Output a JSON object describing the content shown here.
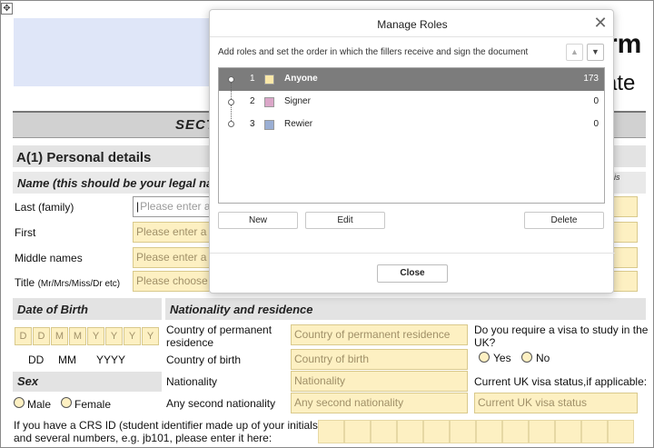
{
  "form": {
    "title_right_1": "rm",
    "title_right_2": "ate",
    "section_title": "SECT",
    "section_a1": "A(1) Personal details",
    "name_subhead": "Name (this should be your legal na",
    "name_subhead_right": "is",
    "rows": [
      {
        "label": "Last (family)",
        "placeholder": "Please enter a l"
      },
      {
        "label": "First",
        "placeholder": "Please enter a f"
      },
      {
        "label": "Middle names",
        "placeholder": "Please enter a n"
      },
      {
        "label": "Title",
        "label_small": "(Mr/Mrs/Miss/Dr etc)",
        "placeholder": "Please choose a"
      }
    ],
    "dob": {
      "heading": "Date of Birth",
      "boxes": [
        "D",
        "D",
        "M",
        "M",
        "Y",
        "Y",
        "Y",
        "Y"
      ],
      "dd": "DD",
      "mm": "MM",
      "yyyy": "YYYY"
    },
    "nationality": {
      "heading": "Nationality and residence",
      "perm_label_1": "Country of permanent",
      "perm_label_2": "residence",
      "perm_placeholder": "Country of permanent residence",
      "birth_label": "Country of birth",
      "birth_placeholder": "Country of birth",
      "nat_label": "Nationality",
      "nat_placeholder": "Nationality",
      "second_label": "Any second nationality",
      "second_placeholder": "Any second nationality"
    },
    "visa": {
      "question_1": "Do you require a visa to study in the",
      "question_2": "UK?",
      "yes": "Yes",
      "no": "No",
      "status_label": "Current UK visa status,if applicable:",
      "status_placeholder": "Current UK visa status"
    },
    "sex": {
      "heading": "Sex",
      "male": "Male",
      "female": "Female"
    },
    "crs": {
      "line1": "If you have a CRS ID (student identifier made up of your initials",
      "line2": "and several numbers, e.g. jb101, please enter it here:"
    }
  },
  "dialog": {
    "title": "Manage Roles",
    "close_glyph": "✕",
    "description": "Add roles and set the order in which the fillers receive and sign the document",
    "up_glyph": "▲",
    "down_glyph": "▼",
    "roles": [
      {
        "num": "1",
        "name": "Anyone",
        "count": "173",
        "color": "#fbe8a8",
        "selected": true
      },
      {
        "num": "2",
        "name": "Signer",
        "count": "0",
        "color": "#dba6c8",
        "selected": false
      },
      {
        "num": "3",
        "name": "Rewier",
        "count": "0",
        "color": "#9aaed3",
        "selected": false
      }
    ],
    "new_label": "New",
    "edit_label": "Edit",
    "delete_label": "Delete",
    "close_label": "Close"
  }
}
